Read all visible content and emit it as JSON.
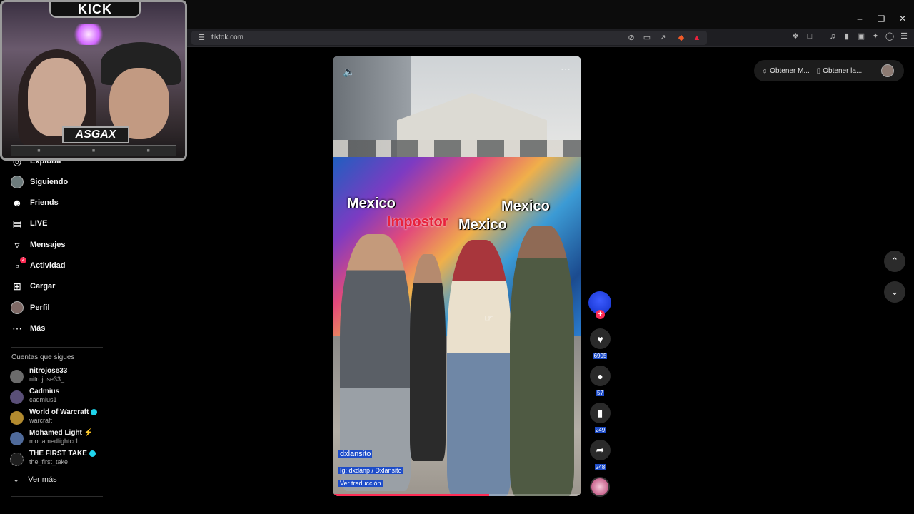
{
  "browser": {
    "url": "tiktok.com",
    "window_controls": [
      "minimize",
      "restore",
      "close"
    ]
  },
  "webcam": {
    "platform_label": "KICK",
    "streamer_name": "ASGAX"
  },
  "sidebar": {
    "items": [
      {
        "label": "Explorar",
        "icon": "compass-icon"
      },
      {
        "label": "Siguiendo",
        "icon": "avatar"
      },
      {
        "label": "Friends",
        "icon": "friends-icon"
      },
      {
        "label": "LIVE",
        "icon": "live-icon"
      },
      {
        "label": "Mensajes",
        "icon": "send-icon"
      },
      {
        "label": "Actividad",
        "icon": "activity-icon",
        "badge": "2"
      },
      {
        "label": "Cargar",
        "icon": "upload-icon"
      },
      {
        "label": "Perfil",
        "icon": "avatar"
      },
      {
        "label": "Más",
        "icon": "more-icon"
      }
    ],
    "following_title": "Cuentas que sigues",
    "following": [
      {
        "name": "nitrojose33",
        "handle": "nitrojose33_"
      },
      {
        "name": "Cadmius",
        "handle": "cadmius1"
      },
      {
        "name": "World of Warcraft",
        "handle": "warcraft",
        "verified": true
      },
      {
        "name": "Mohamed Light ⚡",
        "handle": "mohamedlightcr1"
      },
      {
        "name": "THE FIRST TAKE",
        "handle": "the_first_take",
        "verified": true
      }
    ],
    "see_more": "Ver más"
  },
  "video": {
    "captions": [
      "Mexico",
      "Impostor",
      "Mexico",
      "Mexico"
    ],
    "author": "dxlansito",
    "description": "Ig: dxdanp / Dxlansito",
    "translate": "Ver traducción",
    "progress": 0.63
  },
  "actions": {
    "likes": "6905",
    "comments": "57",
    "saves": "249",
    "shares": "248"
  },
  "top_pill": {
    "item1": "Obtener M...",
    "item2": "Obtener la..."
  },
  "colors": {
    "accent": "#fe2c55",
    "selection": "#1d4cc8",
    "verified": "#20d5ec"
  }
}
